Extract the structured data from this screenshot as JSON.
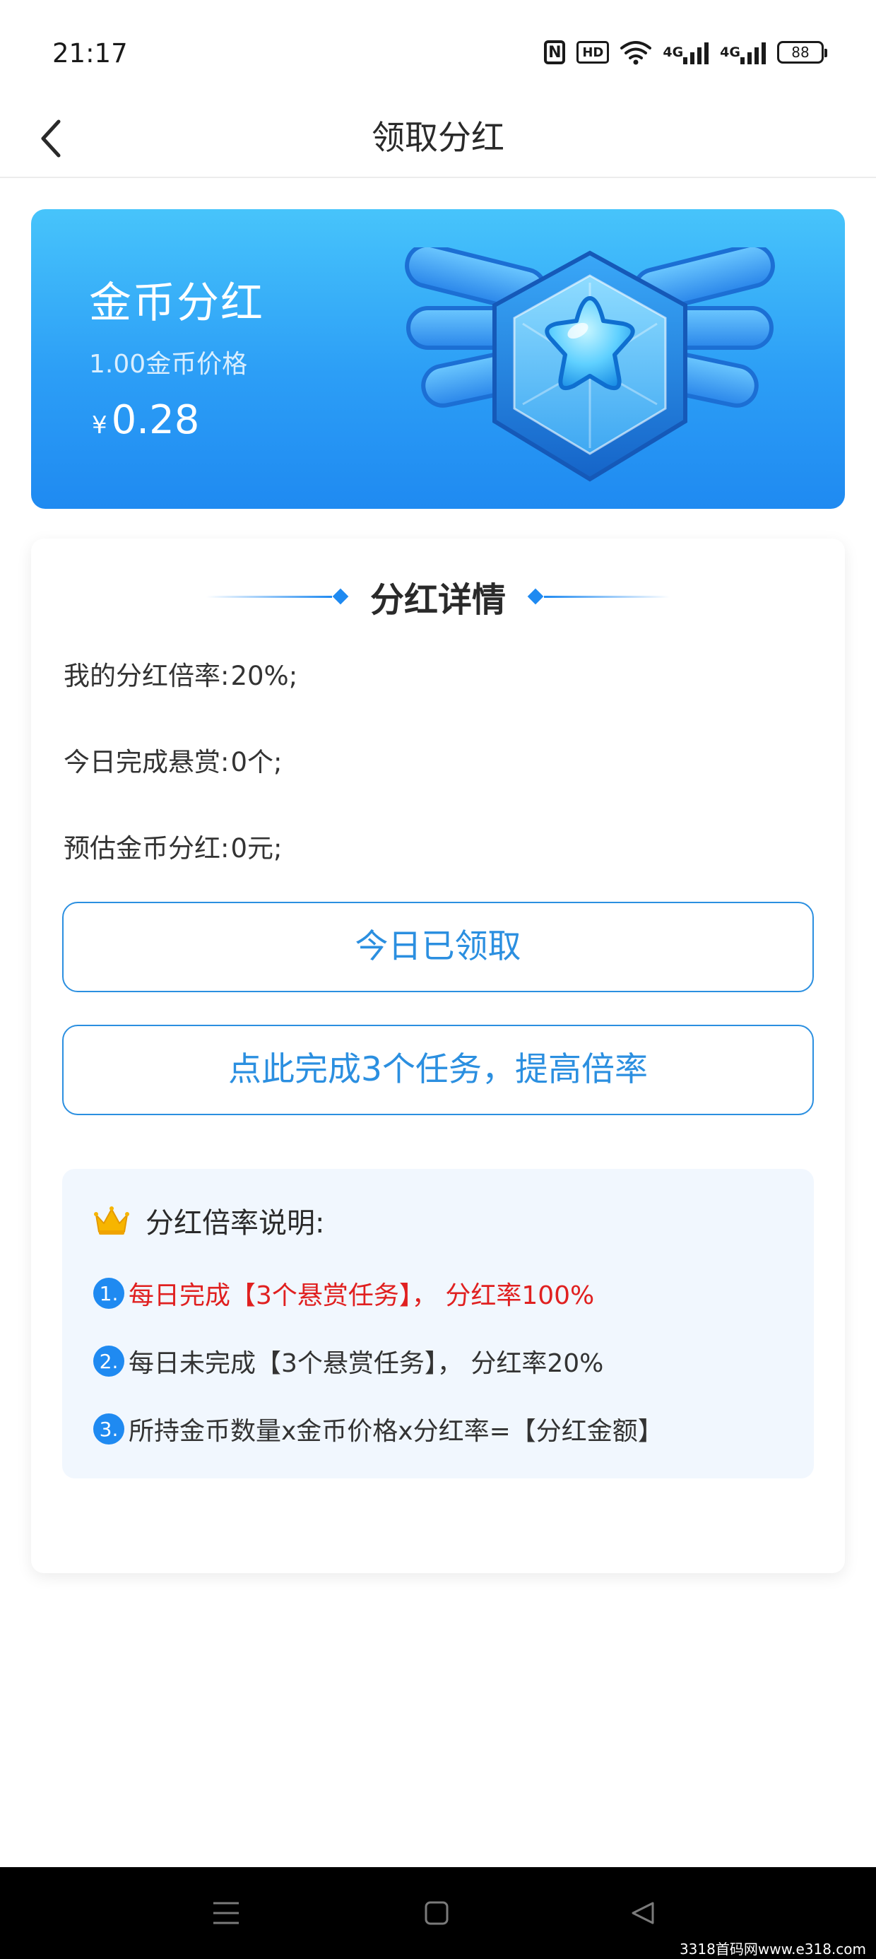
{
  "status_bar": {
    "time": "21:17",
    "nfc": "N",
    "hd": "HD",
    "net1": "4G",
    "net2": "4G",
    "battery": "88"
  },
  "nav": {
    "title": "领取分红",
    "back_icon": "chevron-left-icon"
  },
  "hero": {
    "title": "金币分红",
    "price_label": "1.00金币价格",
    "currency": "¥",
    "amount": "0.28",
    "badge_icon": "winged-star-badge-icon",
    "gradient_top": "#47c4fb",
    "gradient_bottom": "#1f8af1"
  },
  "detail": {
    "title": "分红详情",
    "rows": [
      {
        "label": "我的分红倍率:",
        "value": "20%;"
      },
      {
        "label": "今日完成悬赏:",
        "value": "0个;"
      },
      {
        "label": "预估金币分红:",
        "value": "0元;"
      }
    ],
    "claimed_button": "今日已领取",
    "task_button": "点此完成3个任务，提高倍率",
    "accent": "#2b8fe0"
  },
  "rules": {
    "icon": "crown-icon",
    "title": "分红倍率说明:",
    "items": [
      {
        "num": "1.",
        "text": "每日完成【3个悬赏任务】， 分红率100%",
        "highlight": true
      },
      {
        "num": "2.",
        "text": "每日未完成【3个悬赏任务】， 分红率20%",
        "highlight": false
      },
      {
        "num": "3.",
        "text": "所持金币数量x金币价格x分红率=【分红金额】",
        "highlight": false
      }
    ],
    "highlight_color": "#e02020"
  },
  "system_nav": {
    "menu_icon": "menu-icon",
    "home_icon": "home-square-icon",
    "back_icon": "back-triangle-icon",
    "watermark": "3318首码网www.e318.com"
  }
}
